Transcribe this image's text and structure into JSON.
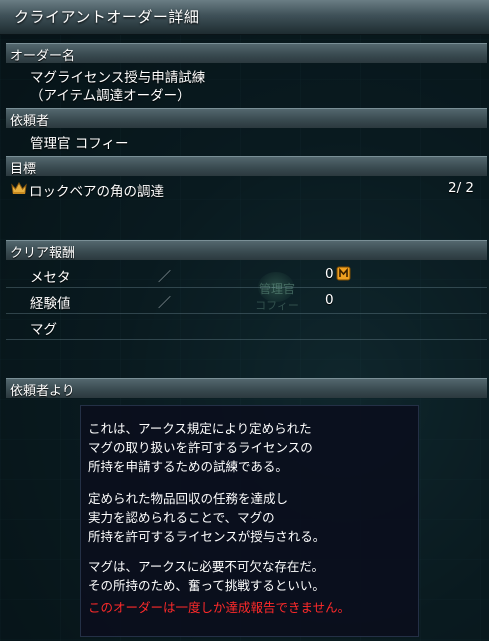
{
  "window": {
    "title": "クライアントオーダー詳細"
  },
  "sections": {
    "order_name": {
      "header": "オーダー名",
      "line1": "マグライセンス授与申請試練",
      "line2": "（アイテム調達オーダー）"
    },
    "client": {
      "header": "依頼者",
      "value": "管理官 コフィー"
    },
    "goal": {
      "header": "目標",
      "item": "ロックベアの角の調達",
      "progress": "2/ 2",
      "icon": "crown-icon"
    },
    "reward": {
      "header": "クリア報酬",
      "rows": [
        {
          "label": "メセタ",
          "slash": "／",
          "value": "0",
          "icon": "meseta-icon"
        },
        {
          "label": "経験値",
          "slash": "／",
          "value": "0"
        },
        {
          "label": "マグ"
        }
      ],
      "watermark_line1": "管理官",
      "watermark_line2": "コフィー"
    },
    "message": {
      "header": "依頼者より",
      "lines": [
        "これは、アークス規定により定められた",
        "マグの取り扱いを許可するライセンスの",
        "所持を申請するための試練である。",
        "定められた物品回収の任務を達成し",
        "実力を認められることで、マグの",
        "所持を許可するライセンスが授与される。",
        "マグは、アークスに必要不可欠な存在だ。",
        "その所持のため、奮って挑戦するといい。"
      ],
      "warning": "このオーダーは一度しか達成報告できません。"
    }
  },
  "colors": {
    "warning": "#ff2a2a",
    "crown": "#e8b040",
    "meseta": "#f0a020"
  }
}
